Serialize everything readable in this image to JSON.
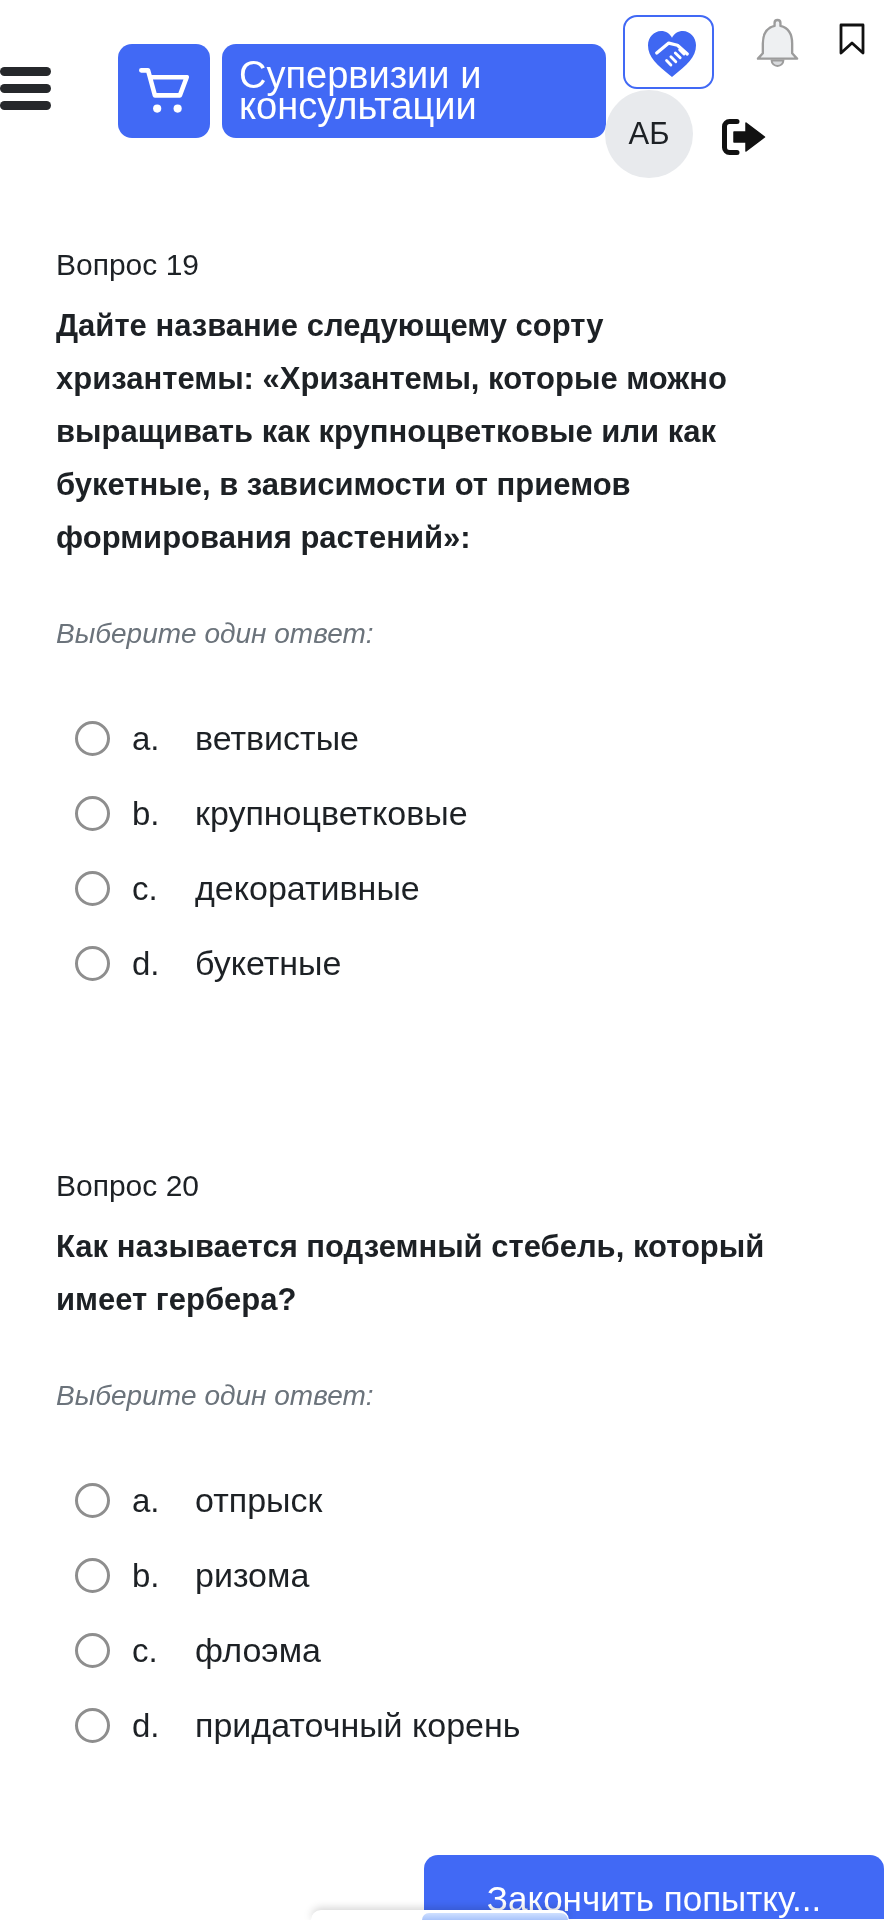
{
  "header": {
    "supervision_button": {
      "label": "Супервизии и консультации"
    },
    "avatar": {
      "initials": "АБ"
    }
  },
  "questions": [
    {
      "number_label": "Вопрос 19",
      "text": "Дайте название следующему сорту хризантемы: «Хризантемы, которые можно выращивать как крупноцветковые или как букетные, в зависимости от приемов формирования растений»:",
      "prompt": "Выберите один ответ:",
      "options": [
        {
          "letter": "a.",
          "text": "ветвистые",
          "selected": false
        },
        {
          "letter": "b.",
          "text": "крупноцветковые",
          "selected": false
        },
        {
          "letter": "c.",
          "text": "декоративные",
          "selected": false
        },
        {
          "letter": "d.",
          "text": "букетные",
          "selected": false
        }
      ]
    },
    {
      "number_label": "Вопрос 20",
      "text": "Как называется подземный стебель, который имеет гербера?",
      "prompt": "Выберите один ответ:",
      "options": [
        {
          "letter": "a.",
          "text": "отпрыск",
          "selected": false
        },
        {
          "letter": "b.",
          "text": "ризома",
          "selected": false
        },
        {
          "letter": "c.",
          "text": "флоэма",
          "selected": false
        },
        {
          "letter": "d.",
          "text": "придаточный корень",
          "selected": false
        }
      ]
    }
  ],
  "finish_button": {
    "label": "Закончить попытку..."
  }
}
